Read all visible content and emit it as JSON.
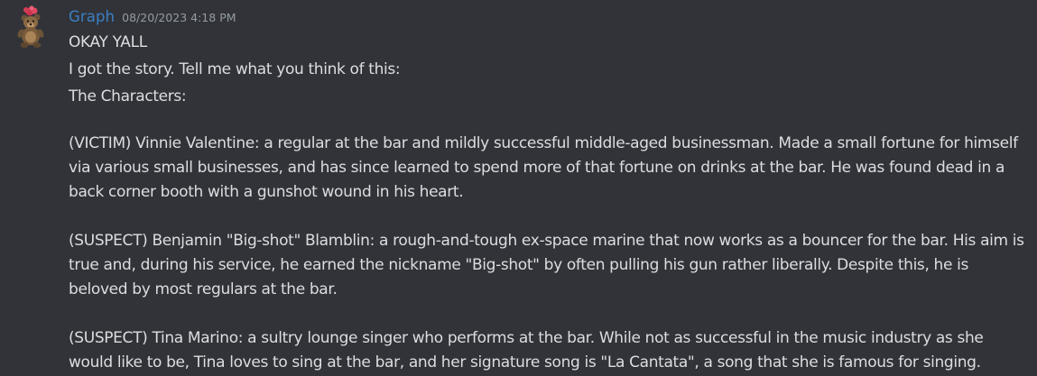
{
  "message": {
    "username": "Graph",
    "timestamp": "08/20/2023 4:18 PM",
    "avatar_icon": "bear-with-red-flower-avatar-icon",
    "colors": {
      "background": "#313338",
      "username": "#3b7fc4",
      "text": "#dbdee1",
      "timestamp": "#949ba4"
    },
    "lines": [
      "OKAY YALL",
      "I got the story. Tell me what you think of this:",
      "The Characters:"
    ],
    "paragraphs": [
      "(VICTIM) Vinnie Valentine: a regular at the bar and mildly successful middle-aged businessman. Made a small fortune for himself via various small businesses, and has since learned to spend more of that fortune on drinks at the bar. He was found dead in a back corner booth with a gunshot wound in his heart.",
      "(SUSPECT) Benjamin \"Big-shot\" Blamblin: a rough-and-tough ex-space marine that now works as a bouncer for the bar. His aim is true and, during his service, he earned the nickname \"Big-shot\" by often pulling his gun rather liberally. Despite this, he is beloved by most regulars at the bar.",
      "(SUSPECT) Tina Marino: a sultry lounge singer who performs at the bar. While not as successful in the music industry as she would like to be, Tina loves to sing at the bar, and her signature song is \"La Cantata\", a song that she is famous for singing."
    ]
  }
}
